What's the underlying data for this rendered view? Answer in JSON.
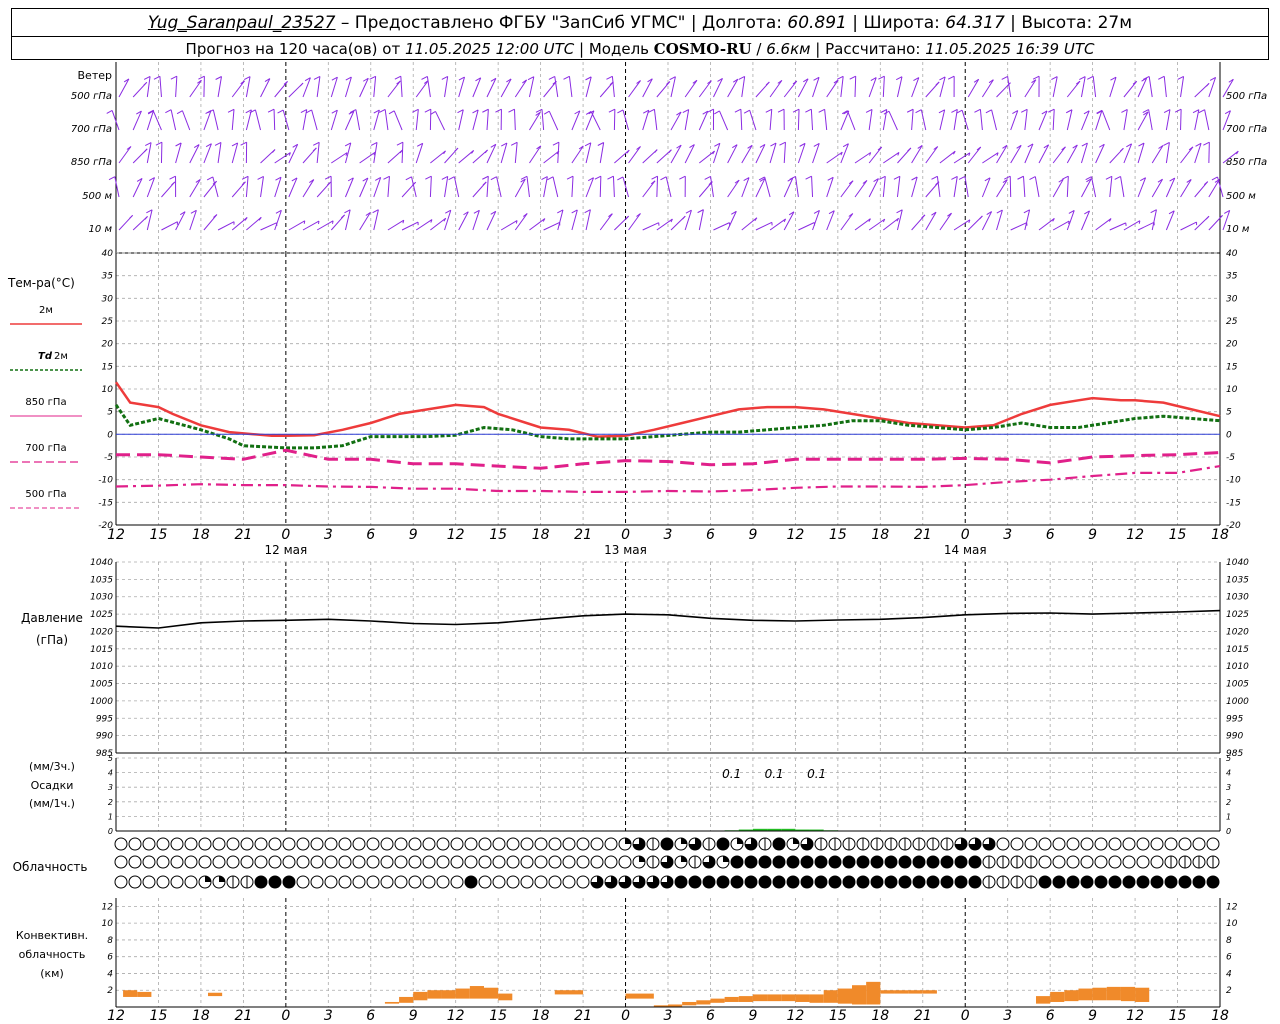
{
  "header": {
    "station": "Yug_Saranpaul_23527",
    "provider": "Предоставлено ФГБУ \"ЗапСиб УГМС\"",
    "lon_label": "Долгота:",
    "lon_value": "60.891",
    "lat_label": "Широта:",
    "lat_value": "64.317",
    "alt_label": "Высота:",
    "alt_value": "27м",
    "forecast_prefix": "Прогноз на 120 часа(ов) от",
    "forecast_start": "11.05.2025 12:00 UTC",
    "model_label": "Модель",
    "model_name": "COSMO-RU",
    "model_res": "6.6км",
    "computed_label": "Рассчитано:",
    "computed_time": "11.05.2025 16:39 UTC"
  },
  "colors": {
    "wind": "#8a2be2",
    "t2m": "#ee3b3b",
    "td2m": "#127012",
    "t850": "#2e3fd6",
    "t700": "#e0208a",
    "t500": "#e0208a",
    "pressure": "#000000",
    "precip": "#22bb22",
    "convective": "#f08a2a",
    "grid": "#aaaaaa"
  },
  "chart_data": {
    "time_axis": {
      "tick_labels": [
        "12",
        "15",
        "18",
        "21",
        "0",
        "3",
        "6",
        "9",
        "12",
        "15",
        "18",
        "21",
        "0",
        "3",
        "6",
        "9",
        "12",
        "15",
        "18",
        "21",
        "0",
        "3",
        "6",
        "9",
        "12",
        "15",
        "18"
      ],
      "day_labels": [
        {
          "label": "12 мая",
          "at_hour": 12
        },
        {
          "label": "13 мая",
          "at_hour": 36
        },
        {
          "label": "14 мая",
          "at_hour": 60
        }
      ],
      "midnights_hours": [
        12,
        36,
        60
      ]
    },
    "panels": [
      {
        "id": "wind",
        "type": "wind-barbs",
        "title": "Ветер",
        "levels": [
          "500 гПа",
          "700 гПа",
          "850 гПа",
          "500 м",
          "10 м"
        ]
      },
      {
        "id": "temperature",
        "type": "line",
        "title": "Тем-ра(°C)",
        "ylim": [
          -20,
          40
        ],
        "yticks": [
          40,
          35,
          30,
          25,
          20,
          15,
          10,
          5,
          0,
          -5,
          -10,
          -15,
          -20
        ],
        "legend": [
          {
            "label": "2м",
            "key": "t2m"
          },
          {
            "label_prefix": "Td",
            "label": "2м",
            "key": "td2m"
          },
          {
            "label": "850 гПа",
            "key": "t850"
          },
          {
            "label": "700 гПа",
            "key": "t700"
          },
          {
            "label": "500 гПа",
            "key": "t500"
          }
        ],
        "series": [
          {
            "key": "t2m",
            "hours": [
              0,
              1,
              3,
              4,
              6,
              8,
              9,
              11,
              12,
              14,
              16,
              18,
              20,
              22,
              24,
              26,
              27,
              29,
              30,
              32,
              34,
              36,
              38,
              40,
              42,
              44,
              46,
              48,
              50,
              52,
              54,
              56,
              58,
              60,
              62,
              64,
              66,
              68,
              69,
              71,
              72,
              74,
              76,
              78
            ],
            "values": [
              11.5,
              7,
              6,
              4.5,
              2,
              0.5,
              0.2,
              -0.3,
              -0.3,
              -0.2,
              1,
              2.5,
              4.5,
              5.5,
              6.5,
              6,
              4.5,
              2.5,
              1.5,
              1,
              -0.5,
              -0.3,
              1,
              2.5,
              4,
              5.5,
              6,
              6,
              5.5,
              4.5,
              3.5,
              2.5,
              2,
              1.5,
              2,
              4.5,
              6.5,
              7.5,
              8,
              7.5,
              7.5,
              7,
              5.5,
              4
            ]
          },
          {
            "key": "td2m",
            "hours": [
              0,
              1,
              3,
              6,
              8,
              9,
              12,
              14,
              16,
              18,
              20,
              22,
              24,
              26,
              28,
              30,
              32,
              34,
              36,
              38,
              40,
              42,
              44,
              46,
              48,
              50,
              52,
              54,
              56,
              58,
              60,
              62,
              64,
              66,
              68,
              70,
              72,
              74,
              76,
              78
            ],
            "values": [
              6.5,
              2,
              3.5,
              1,
              -1,
              -2.5,
              -3,
              -3,
              -2.5,
              -0.5,
              -0.5,
              -0.5,
              -0.2,
              1.5,
              1,
              -0.5,
              -1,
              -1,
              -1,
              -0.5,
              0,
              0.5,
              0.5,
              1,
              1.5,
              2,
              3,
              3,
              2,
              1.5,
              1,
              1.5,
              2.5,
              1.5,
              1.5,
              2.5,
              3.5,
              4,
              3.5,
              3
            ]
          },
          {
            "key": "t850",
            "hours": [
              0,
              78
            ],
            "values": [
              0,
              0
            ]
          },
          {
            "key": "t700",
            "hours": [
              0,
              3,
              6,
              9,
              12,
              15,
              18,
              21,
              24,
              27,
              30,
              33,
              36,
              39,
              42,
              45,
              48,
              51,
              54,
              57,
              60,
              63,
              66,
              69,
              72,
              75,
              78
            ],
            "values": [
              -4.5,
              -4.5,
              -5,
              -5.5,
              -3.5,
              -5.5,
              -5.5,
              -6.5,
              -6.5,
              -7,
              -7.5,
              -6.5,
              -5.8,
              -6,
              -6.7,
              -6.5,
              -5.5,
              -5.5,
              -5.5,
              -5.5,
              -5.3,
              -5.5,
              -6.3,
              -5,
              -4.7,
              -4.5,
              -4
            ]
          },
          {
            "key": "t500",
            "hours": [
              0,
              3,
              6,
              9,
              12,
              15,
              18,
              21,
              24,
              27,
              30,
              33,
              36,
              39,
              42,
              45,
              48,
              51,
              54,
              57,
              60,
              63,
              66,
              69,
              72,
              75,
              78
            ],
            "values": [
              -11.5,
              -11.3,
              -11,
              -11.2,
              -11.2,
              -11.5,
              -11.6,
              -12,
              -12,
              -12.5,
              -12.5,
              -12.7,
              -12.7,
              -12.5,
              -12.6,
              -12.3,
              -11.8,
              -11.5,
              -11.5,
              -11.6,
              -11.2,
              -10.5,
              -10,
              -9.2,
              -8.5,
              -8.5,
              -7
            ]
          }
        ]
      },
      {
        "id": "pressure",
        "type": "line",
        "title": "Давление",
        "unit": "(гПа)",
        "ylim": [
          985,
          1040
        ],
        "yticks": [
          1040,
          1035,
          1030,
          1025,
          1020,
          1015,
          1010,
          1005,
          1000,
          995,
          990,
          985
        ],
        "series": [
          {
            "key": "pressure",
            "hours": [
              0,
              3,
              6,
              9,
              12,
              15,
              18,
              21,
              24,
              27,
              30,
              33,
              36,
              39,
              42,
              45,
              48,
              51,
              54,
              57,
              60,
              63,
              66,
              69,
              72,
              75,
              78
            ],
            "values": [
              1021.5,
              1021,
              1022.5,
              1023,
              1023.2,
              1023.5,
              1023,
              1022.3,
              1022,
              1022.5,
              1023.5,
              1024.5,
              1025,
              1024.8,
              1023.8,
              1023.2,
              1023,
              1023.3,
              1023.5,
              1024,
              1024.8,
              1025.2,
              1025.3,
              1025,
              1025.3,
              1025.6,
              1026
            ]
          }
        ]
      },
      {
        "id": "precip",
        "type": "bar",
        "title": "Осадки",
        "unit_top": "(мм/3ч.)",
        "unit_bottom": "(мм/1ч.)",
        "ylim": [
          0,
          5
        ],
        "yticks": [
          5,
          4,
          3,
          2,
          1,
          0
        ],
        "labels": [
          {
            "text": "0.1",
            "at_hour": 43.5
          },
          {
            "text": "0.1",
            "at_hour": 46.5
          },
          {
            "text": "0.1",
            "at_hour": 49.5
          }
        ],
        "bars": {
          "hours": [
            43,
            44,
            45,
            46,
            47,
            48,
            49,
            50,
            51
          ],
          "values": [
            0.05,
            0.1,
            0.15,
            0.15,
            0.15,
            0.1,
            0.1,
            0.05,
            0.02
          ]
        }
      },
      {
        "id": "cloudiness",
        "type": "symbol-rows",
        "title": "Облачность",
        "rows_count": 3,
        "columns": 79
      },
      {
        "id": "convective",
        "type": "bar",
        "title_lines": [
          "Конвективн.",
          "облачность",
          "(км)"
        ],
        "ylim": [
          0,
          13
        ],
        "yticks": [
          12,
          10,
          8,
          6,
          4,
          2
        ],
        "bars": [
          {
            "h0": 0.5,
            "h1": 1.5,
            "bottom": 1.2,
            "top": 2
          },
          {
            "h0": 1.5,
            "h1": 2.5,
            "bottom": 1.2,
            "top": 1.8
          },
          {
            "h0": 6.5,
            "h1": 7.5,
            "bottom": 1.3,
            "top": 1.7
          },
          {
            "h0": 19,
            "h1": 20,
            "bottom": 0.4,
            "top": 0.6
          },
          {
            "h0": 20,
            "h1": 21,
            "bottom": 0.5,
            "top": 1.2
          },
          {
            "h0": 21,
            "h1": 22,
            "bottom": 0.8,
            "top": 1.8
          },
          {
            "h0": 22,
            "h1": 23,
            "bottom": 1,
            "top": 2
          },
          {
            "h0": 23,
            "h1": 24,
            "bottom": 1,
            "top": 2
          },
          {
            "h0": 24,
            "h1": 25,
            "bottom": 1,
            "top": 2.2
          },
          {
            "h0": 25,
            "h1": 26,
            "bottom": 1,
            "top": 2.5
          },
          {
            "h0": 26,
            "h1": 27,
            "bottom": 1,
            "top": 2.3
          },
          {
            "h0": 27,
            "h1": 28,
            "bottom": 0.8,
            "top": 1.6
          },
          {
            "h0": 31,
            "h1": 33,
            "bottom": 1.5,
            "top": 2
          },
          {
            "h0": 36,
            "h1": 38,
            "bottom": 1,
            "top": 1.6
          },
          {
            "h0": 38,
            "h1": 39,
            "bottom": 0,
            "top": 0.2
          },
          {
            "h0": 39,
            "h1": 40,
            "bottom": 0,
            "top": 0.3
          },
          {
            "h0": 40,
            "h1": 41,
            "bottom": 0.2,
            "top": 0.6
          },
          {
            "h0": 41,
            "h1": 42,
            "bottom": 0.3,
            "top": 0.8
          },
          {
            "h0": 42,
            "h1": 43,
            "bottom": 0.5,
            "top": 1
          },
          {
            "h0": 43,
            "h1": 44,
            "bottom": 0.6,
            "top": 1.2
          },
          {
            "h0": 44,
            "h1": 45,
            "bottom": 0.6,
            "top": 1.3
          },
          {
            "h0": 45,
            "h1": 46,
            "bottom": 0.7,
            "top": 1.5
          },
          {
            "h0": 46,
            "h1": 47,
            "bottom": 0.7,
            "top": 1.5
          },
          {
            "h0": 47,
            "h1": 48,
            "bottom": 0.7,
            "top": 1.5
          },
          {
            "h0": 48,
            "h1": 49,
            "bottom": 0.6,
            "top": 1.5
          },
          {
            "h0": 49,
            "h1": 50,
            "bottom": 0.5,
            "top": 1.5
          },
          {
            "h0": 50,
            "h1": 51,
            "bottom": 0.5,
            "top": 2
          },
          {
            "h0": 51,
            "h1": 52,
            "bottom": 0.4,
            "top": 2.2
          },
          {
            "h0": 52,
            "h1": 53,
            "bottom": 0.3,
            "top": 2.6
          },
          {
            "h0": 53,
            "h1": 54,
            "bottom": 0.3,
            "top": 3
          },
          {
            "h0": 54,
            "h1": 55,
            "bottom": 1.6,
            "top": 2
          },
          {
            "h0": 55,
            "h1": 56,
            "bottom": 1.6,
            "top": 2
          },
          {
            "h0": 56,
            "h1": 57,
            "bottom": 1.6,
            "top": 2
          },
          {
            "h0": 57,
            "h1": 58,
            "bottom": 1.6,
            "top": 2
          },
          {
            "h0": 65,
            "h1": 66,
            "bottom": 0.4,
            "top": 1.3
          },
          {
            "h0": 66,
            "h1": 67,
            "bottom": 0.6,
            "top": 1.8
          },
          {
            "h0": 67,
            "h1": 68,
            "bottom": 0.7,
            "top": 2
          },
          {
            "h0": 68,
            "h1": 69,
            "bottom": 0.8,
            "top": 2.2
          },
          {
            "h0": 69,
            "h1": 70,
            "bottom": 0.8,
            "top": 2.3
          },
          {
            "h0": 70,
            "h1": 71,
            "bottom": 0.8,
            "top": 2.4
          },
          {
            "h0": 71,
            "h1": 72,
            "bottom": 0.7,
            "top": 2.4
          },
          {
            "h0": 72,
            "h1": 73,
            "bottom": 0.6,
            "top": 2.3
          }
        ]
      }
    ]
  }
}
